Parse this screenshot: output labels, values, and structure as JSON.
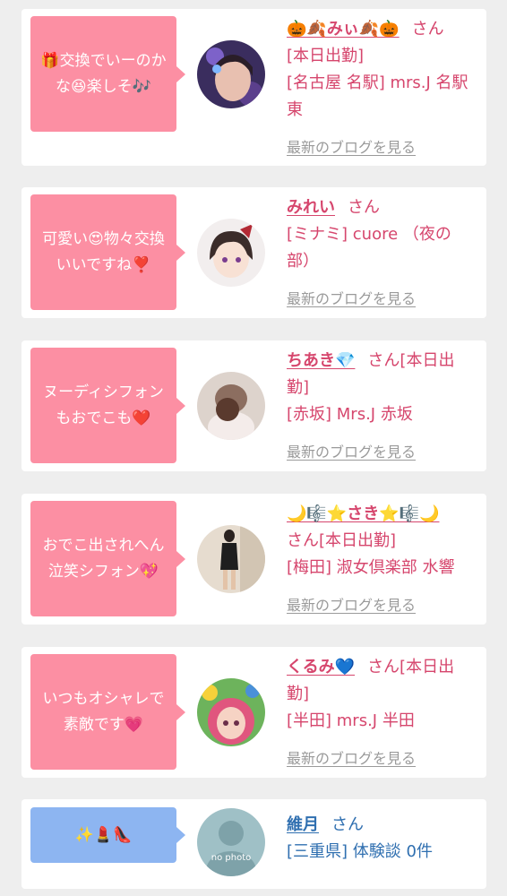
{
  "cards": [
    {
      "bubble_text": "🎁交換でいーのかな😆楽しそ🎶",
      "name": "🎃🍂みぃ🍂🎃",
      "san": "さん",
      "status": "[本日出勤]",
      "shop": "[名古屋 名駅] mrs.J 名駅東",
      "blog_link": "最新のブログを見る"
    },
    {
      "bubble_text": "可愛い😍物々交換いいですね❣️",
      "name": "みれい",
      "san": "さん",
      "status": "",
      "shop": "[ミナミ] cuore （夜の部）",
      "blog_link": "最新のブログを見る"
    },
    {
      "bubble_text": "ヌーディシフォンもおでこも❤️",
      "name": "ちあき💎",
      "san": "さん[本日出勤]",
      "status": "",
      "shop": "[赤坂] Mrs.J 赤坂",
      "blog_link": "最新のブログを見る"
    },
    {
      "bubble_text": "おでこ出されへん泣笑シフォン💖",
      "name": "🌙🎼⭐さき⭐🎼🌙",
      "san": "さん[本日出勤]",
      "status": "",
      "shop": "[梅田] 淑女倶楽部 水響",
      "blog_link": "最新のブログを見る"
    },
    {
      "bubble_text": "いつもオシャレで素敵です💗",
      "name": "くるみ💙",
      "san": "さん[本日出勤]",
      "status": "",
      "shop": "[半田] mrs.J 半田",
      "blog_link": "最新のブログを見る"
    },
    {
      "bubble_text": "✨💄👠",
      "name": "維月",
      "san": "さん",
      "status": "",
      "shop": "[三重県] 体験談 0件",
      "blog_link": "",
      "avatar_text": "no photo"
    }
  ],
  "colors": {
    "pink_bubble": "#fc8fa3",
    "blue_bubble": "#8db5f1",
    "name_pink": "#d6466d",
    "name_blue": "#2f6fb0",
    "link_gray": "#9a9a9a",
    "background": "#eeeeee"
  }
}
